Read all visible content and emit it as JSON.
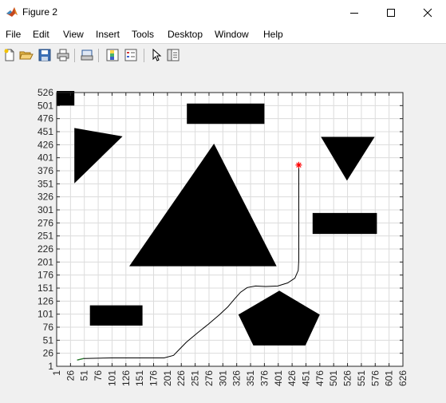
{
  "window": {
    "title": "Figure 2",
    "minimize_icon": "minimize-icon",
    "maximize_icon": "maximize-icon",
    "close_icon": "close-icon"
  },
  "menu": {
    "items": [
      "File",
      "Edit",
      "View",
      "Insert",
      "Tools",
      "Desktop",
      "Window",
      "Help"
    ]
  },
  "toolbar": {
    "tools": [
      "new-figure-icon",
      "open-icon",
      "save-icon",
      "print-icon",
      "print-preview-icon",
      "colorbar-icon",
      "legend-icon",
      "pointer-icon",
      "property-editor-icon"
    ]
  },
  "colors": {
    "obstacle": "#000000",
    "path": "#000000",
    "start_segment": "#2e7d32",
    "goal_marker": "#ff0000",
    "grid": "#dcdcdc"
  },
  "chart_data": {
    "type": "scatter",
    "title": "",
    "xlabel": "",
    "ylabel": "",
    "xlim": [
      1,
      626
    ],
    "ylim": [
      1,
      526
    ],
    "xticks": [
      1,
      26,
      51,
      76,
      101,
      126,
      151,
      176,
      201,
      226,
      251,
      276,
      301,
      326,
      351,
      376,
      401,
      426,
      451,
      476,
      501,
      526,
      551,
      576,
      601,
      626
    ],
    "yticks": [
      1,
      26,
      51,
      76,
      101,
      126,
      151,
      176,
      201,
      226,
      251,
      276,
      301,
      326,
      351,
      376,
      401,
      426,
      451,
      476,
      501,
      526
    ],
    "grid": true,
    "obstacles": [
      {
        "shape": "rectangle",
        "points": [
          [
            1,
            501
          ],
          [
            33,
            501
          ],
          [
            33,
            529
          ],
          [
            1,
            529
          ]
        ]
      },
      {
        "shape": "rectangle",
        "points": [
          [
            236,
            466
          ],
          [
            376,
            466
          ],
          [
            376,
            505
          ],
          [
            236,
            505
          ]
        ]
      },
      {
        "shape": "triangle",
        "points": [
          [
            33,
            458
          ],
          [
            120,
            442
          ],
          [
            33,
            352
          ]
        ]
      },
      {
        "shape": "triangle",
        "points": [
          [
            285,
            428
          ],
          [
            398,
            193
          ],
          [
            132,
            193
          ]
        ]
      },
      {
        "shape": "triangle",
        "points": [
          [
            478,
            441
          ],
          [
            575,
            441
          ],
          [
            525,
            357
          ]
        ]
      },
      {
        "shape": "rectangle",
        "points": [
          [
            463,
            255
          ],
          [
            579,
            255
          ],
          [
            579,
            295
          ],
          [
            463,
            295
          ]
        ]
      },
      {
        "shape": "rectangle",
        "points": [
          [
            61,
            79
          ],
          [
            156,
            79
          ],
          [
            156,
            118
          ],
          [
            61,
            118
          ]
        ]
      },
      {
        "shape": "pentagon",
        "points": [
          [
            403,
            146
          ],
          [
            476,
            100
          ],
          [
            450,
            41
          ],
          [
            356,
            41
          ],
          [
            329,
            100
          ]
        ]
      }
    ],
    "path": [
      [
        38,
        13
      ],
      [
        50,
        16
      ],
      [
        100,
        17
      ],
      [
        150,
        17
      ],
      [
        195,
        17
      ],
      [
        212,
        22
      ],
      [
        222,
        33
      ],
      [
        235,
        47
      ],
      [
        255,
        65
      ],
      [
        275,
        82
      ],
      [
        295,
        100
      ],
      [
        310,
        115
      ],
      [
        322,
        130
      ],
      [
        333,
        143
      ],
      [
        345,
        152
      ],
      [
        360,
        155
      ],
      [
        378,
        154
      ],
      [
        400,
        155
      ],
      [
        418,
        161
      ],
      [
        431,
        170
      ],
      [
        437,
        185
      ],
      [
        438,
        205
      ],
      [
        438,
        240
      ],
      [
        438,
        300
      ],
      [
        438,
        350
      ],
      [
        438,
        383
      ]
    ],
    "start_segment": [
      [
        38,
        13
      ],
      [
        50,
        16
      ]
    ],
    "goal": {
      "x": 438,
      "y": 387,
      "marker": "*"
    }
  }
}
